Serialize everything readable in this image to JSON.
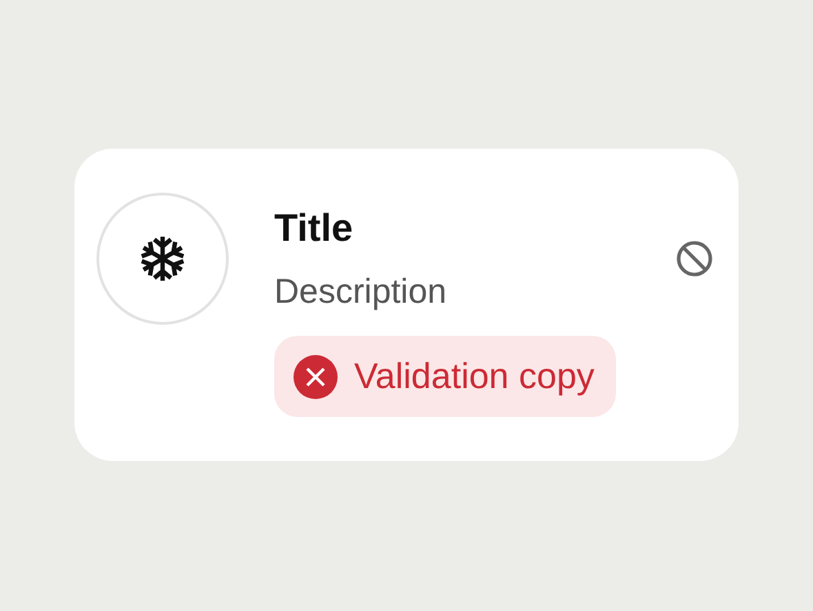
{
  "card": {
    "title": "Title",
    "description": "Description",
    "validation": {
      "message": "Validation copy"
    }
  }
}
